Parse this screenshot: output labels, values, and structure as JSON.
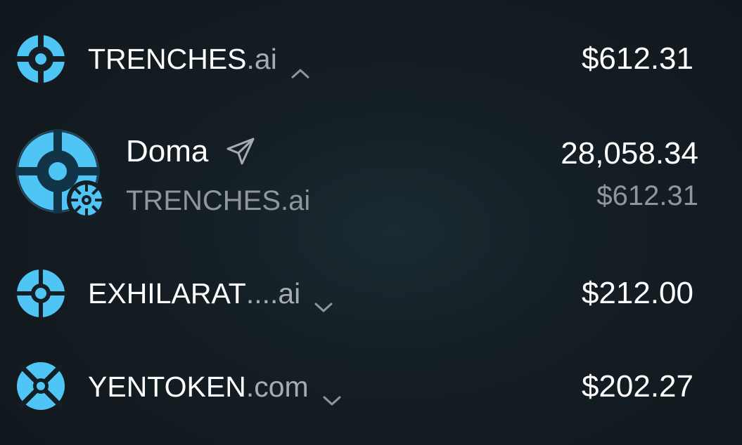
{
  "rows": [
    {
      "icon": "crosshair-logo-icon",
      "name_main": "TRENCHES",
      "name_tld": ".ai",
      "chevron": "chevron-up-icon",
      "value": "$612.31"
    },
    {
      "icon": "quad-petal-logo-icon",
      "name_main": "EXHILARAT",
      "name_tld": "....ai",
      "chevron": "chevron-down-icon",
      "value": "$212.00"
    },
    {
      "icon": "x-split-logo-icon",
      "name_main": "YENTOKEN",
      "name_tld": ".com",
      "chevron": "chevron-down-icon",
      "value": "$202.27"
    }
  ],
  "token": {
    "name": "Doma",
    "send_icon": "send-icon",
    "domain": "TRENCHES.ai",
    "amount": "28,058.34",
    "fiat_value": "$612.31",
    "avatar_icon": "crosshair-logo-icon",
    "badge_icon": "doma-network-badge-icon"
  },
  "colors": {
    "accent": "#4ec5f4",
    "background": "#141e24",
    "muted_text": "#8f979c"
  }
}
